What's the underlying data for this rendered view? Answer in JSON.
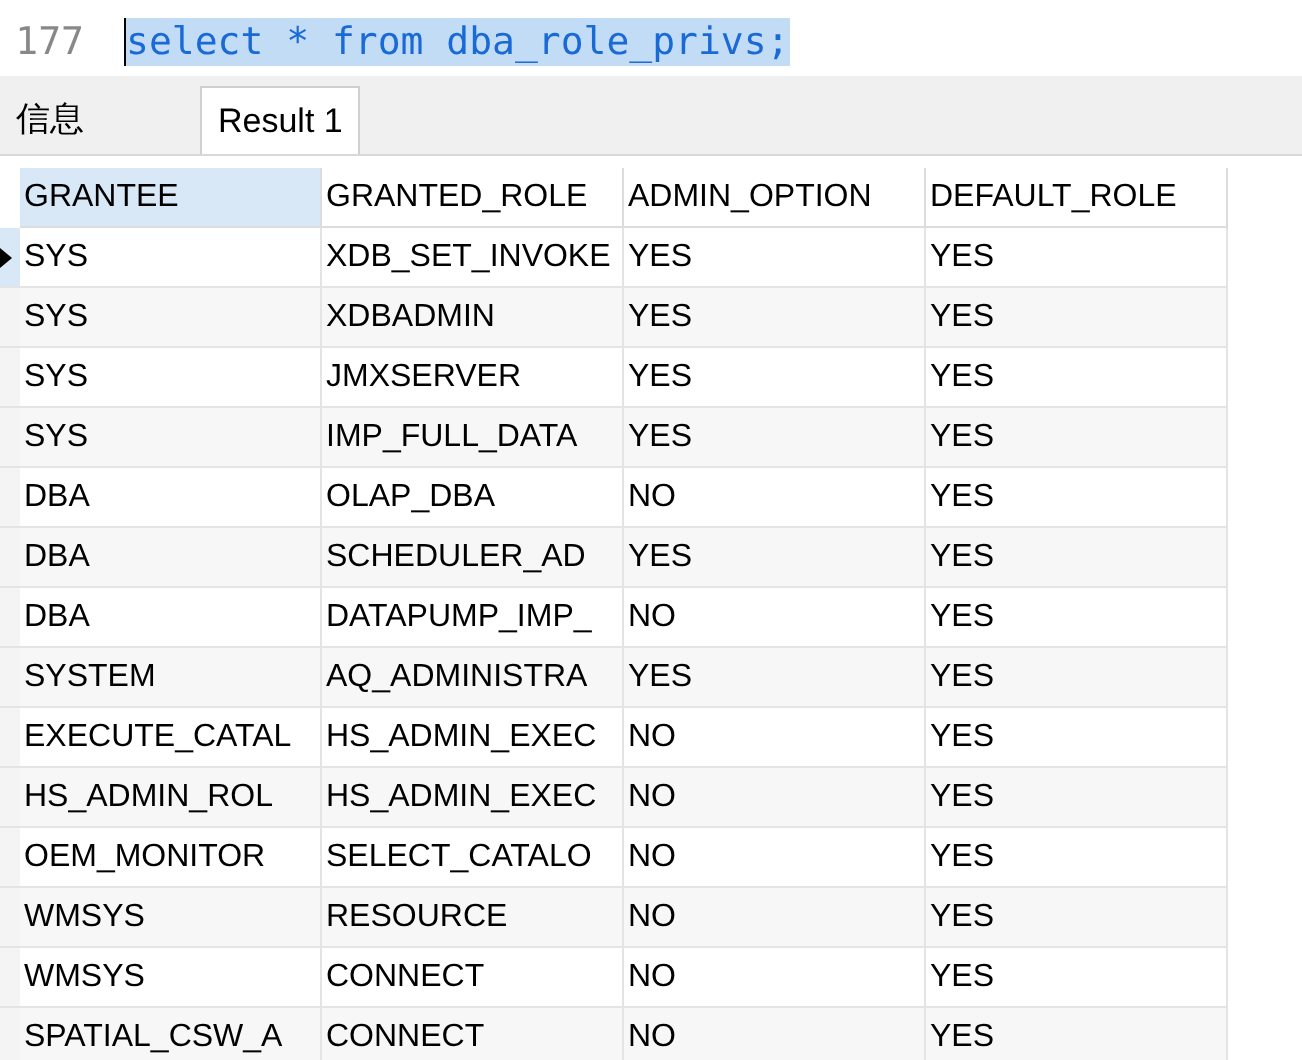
{
  "editor": {
    "lines": [
      {
        "number": "177",
        "code": "select * from dba_role_privs;",
        "selected": true
      }
    ]
  },
  "tabs": [
    {
      "label": "信息",
      "selected": false
    },
    {
      "label": "Result 1",
      "selected": true
    }
  ],
  "table": {
    "columns": [
      "GRANTEE",
      "GRANTED_ROLE",
      "ADMIN_OPTION",
      "DEFAULT_ROLE"
    ],
    "rows": [
      {
        "selected": true,
        "cells": [
          "SYS",
          "XDB_SET_INVOKE",
          "YES",
          "YES"
        ]
      },
      {
        "selected": false,
        "cells": [
          "SYS",
          "XDBADMIN",
          "YES",
          "YES"
        ]
      },
      {
        "selected": false,
        "cells": [
          "SYS",
          "JMXSERVER",
          "YES",
          "YES"
        ]
      },
      {
        "selected": false,
        "cells": [
          "SYS",
          "IMP_FULL_DATA",
          "YES",
          "YES"
        ]
      },
      {
        "selected": false,
        "cells": [
          "DBA",
          "OLAP_DBA",
          "NO",
          "YES"
        ]
      },
      {
        "selected": false,
        "cells": [
          "DBA",
          "SCHEDULER_AD",
          "YES",
          "YES"
        ]
      },
      {
        "selected": false,
        "cells": [
          "DBA",
          "DATAPUMP_IMP_",
          "NO",
          "YES"
        ]
      },
      {
        "selected": false,
        "cells": [
          "SYSTEM",
          "AQ_ADMINISTRA",
          "YES",
          "YES"
        ]
      },
      {
        "selected": false,
        "cells": [
          "EXECUTE_CATAL",
          "HS_ADMIN_EXEC",
          "NO",
          "YES"
        ]
      },
      {
        "selected": false,
        "cells": [
          "HS_ADMIN_ROL",
          "HS_ADMIN_EXEC",
          "NO",
          "YES"
        ]
      },
      {
        "selected": false,
        "cells": [
          "OEM_MONITOR",
          "SELECT_CATALO",
          "NO",
          "YES"
        ]
      },
      {
        "selected": false,
        "cells": [
          "WMSYS",
          "RESOURCE",
          "NO",
          "YES"
        ]
      },
      {
        "selected": false,
        "cells": [
          "WMSYS",
          "CONNECT",
          "NO",
          "YES"
        ]
      },
      {
        "selected": false,
        "cells": [
          "SPATIAL_CSW_A",
          "CONNECT",
          "NO",
          "YES"
        ]
      }
    ]
  }
}
